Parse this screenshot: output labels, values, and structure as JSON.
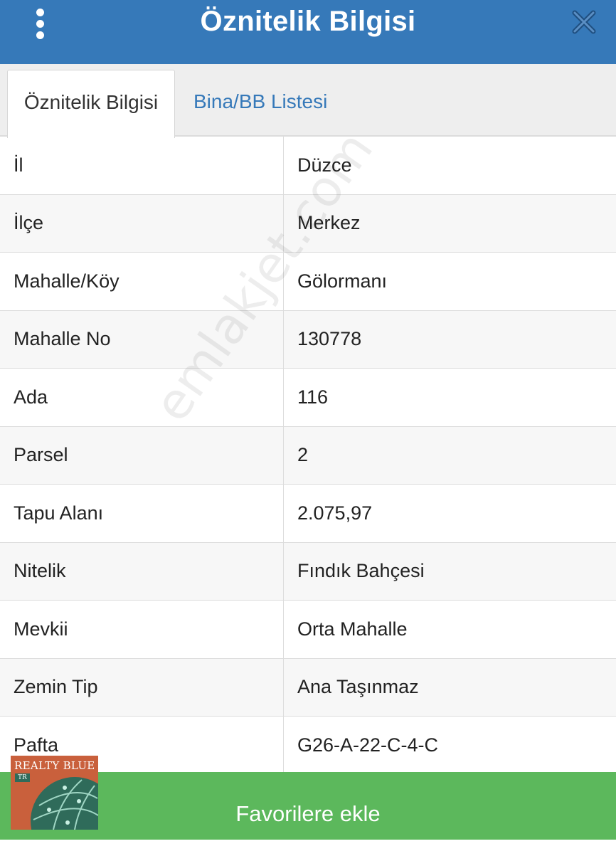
{
  "header": {
    "title": "Öznitelik Bilgisi"
  },
  "tabs": [
    {
      "label": "Öznitelik Bilgisi",
      "active": true
    },
    {
      "label": "Bina/BB Listesi",
      "active": false
    }
  ],
  "attributes": [
    {
      "key": "İl",
      "value": "Düzce"
    },
    {
      "key": "İlçe",
      "value": "Merkez"
    },
    {
      "key": "Mahalle/Köy",
      "value": "Gölormanı"
    },
    {
      "key": "Mahalle No",
      "value": "130778"
    },
    {
      "key": "Ada",
      "value": "116"
    },
    {
      "key": "Parsel",
      "value": "2"
    },
    {
      "key": "Tapu Alanı",
      "value": "2.075,97"
    },
    {
      "key": "Nitelik",
      "value": "Fındık Bahçesi"
    },
    {
      "key": "Mevkii",
      "value": "Orta Mahalle"
    },
    {
      "key": "Zemin Tip",
      "value": "Ana Taşınmaz"
    },
    {
      "key": "Pafta",
      "value": "G26-A-22-C-4-C"
    }
  ],
  "watermark": "emlakjet.com",
  "footer": {
    "favorite_label": "Favorilere ekle"
  },
  "logo": {
    "name": "REALTY BLUE",
    "badge": "TR"
  },
  "colors": {
    "header": "#3679b9",
    "tab_link": "#3679b9",
    "footer": "#5cb85c",
    "logo_bg": "#c9603c"
  }
}
